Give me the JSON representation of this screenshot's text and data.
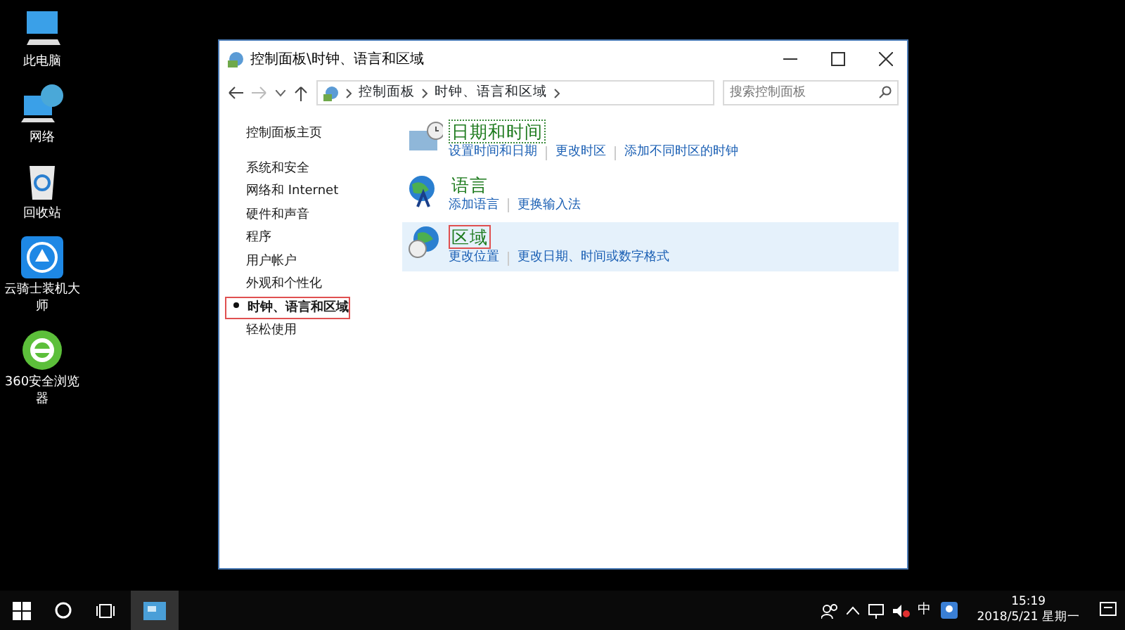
{
  "desktop_icons": [
    {
      "label": "此电脑",
      "kind": "computer"
    },
    {
      "label": "网络",
      "kind": "network"
    },
    {
      "label": "回收站",
      "kind": "recycle"
    },
    {
      "label": "云骑士装机大师",
      "kind": "app-blue"
    },
    {
      "label": "360安全浏览器",
      "kind": "app-green"
    }
  ],
  "window": {
    "title": "控制面板\\时钟、语言和区域",
    "breadcrumb": [
      "控制面板",
      "时钟、语言和区域"
    ],
    "search": {
      "placeholder": "搜索控制面板"
    },
    "sidebar": {
      "home": "控制面板主页",
      "items": [
        {
          "label": "系统和安全",
          "selected": false
        },
        {
          "label": "网络和 Internet",
          "selected": false
        },
        {
          "label": "硬件和声音",
          "selected": false
        },
        {
          "label": "程序",
          "selected": false
        },
        {
          "label": "用户帐户",
          "selected": false
        },
        {
          "label": "外观和个性化",
          "selected": false
        },
        {
          "label": "时钟、语言和区域",
          "selected": true
        },
        {
          "label": "轻松使用",
          "selected": false
        }
      ]
    },
    "categories": [
      {
        "kind": "clock",
        "title": "日期和时间",
        "focused": true,
        "annotated": false,
        "hovered": false,
        "links": [
          "设置时间和日期",
          "更改时区",
          "添加不同时区的时钟"
        ]
      },
      {
        "kind": "language",
        "title": "语言",
        "focused": false,
        "annotated": false,
        "hovered": false,
        "links": [
          "添加语言",
          "更换输入法"
        ]
      },
      {
        "kind": "region",
        "title": "区域",
        "focused": false,
        "annotated": true,
        "hovered": true,
        "links": [
          "更改位置",
          "更改日期、时间或数字格式"
        ]
      }
    ]
  },
  "taskbar": {
    "tray": {
      "ime": "中",
      "time": "15:19",
      "date": "2018/5/21 星期一"
    }
  }
}
